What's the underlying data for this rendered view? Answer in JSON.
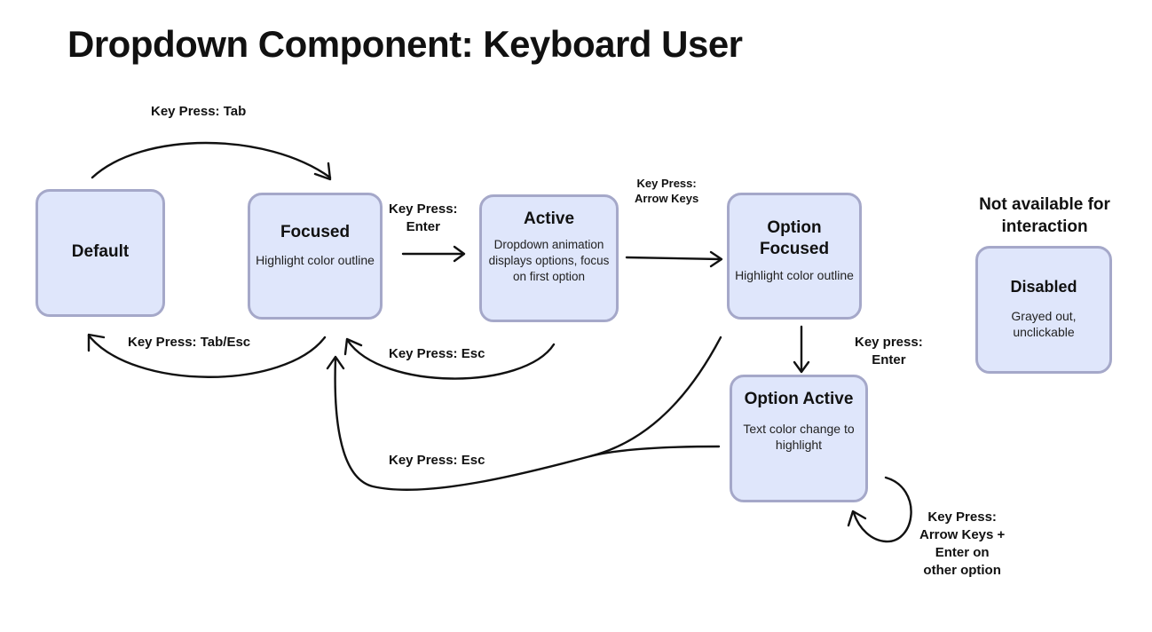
{
  "title": "Dropdown Component: Keyboard User",
  "states": {
    "default": {
      "name": "Default"
    },
    "focused": {
      "name": "Focused",
      "desc": "Highlight color outline"
    },
    "active": {
      "name": "Active",
      "desc": "Dropdown animation displays options, focus on first option"
    },
    "option_focused": {
      "name": "Option Focused",
      "desc": "Highlight color outline"
    },
    "option_active": {
      "name": "Option Active",
      "desc": "Text color change to highlight"
    },
    "disabled": {
      "name": "Disabled",
      "desc": "Grayed out, unclickable"
    }
  },
  "transitions": {
    "tab": "Key Press: Tab",
    "tab_esc": "Key Press: Tab/Esc",
    "enter": "Key Press:\nEnter",
    "esc_active": "Key Press: Esc",
    "arrow_keys": "Key Press:\nArrow Keys",
    "option_enter": "Key press:\nEnter",
    "esc_option": "Key Press: Esc",
    "arrow_enter_other": "Key Press:\nArrow Keys +\nEnter on\nother option"
  },
  "notes": {
    "not_available": "Not available for interaction"
  },
  "colors": {
    "state_fill": "#dfe6fb",
    "state_border": "#a5a8c9",
    "arrow": "#111111"
  }
}
